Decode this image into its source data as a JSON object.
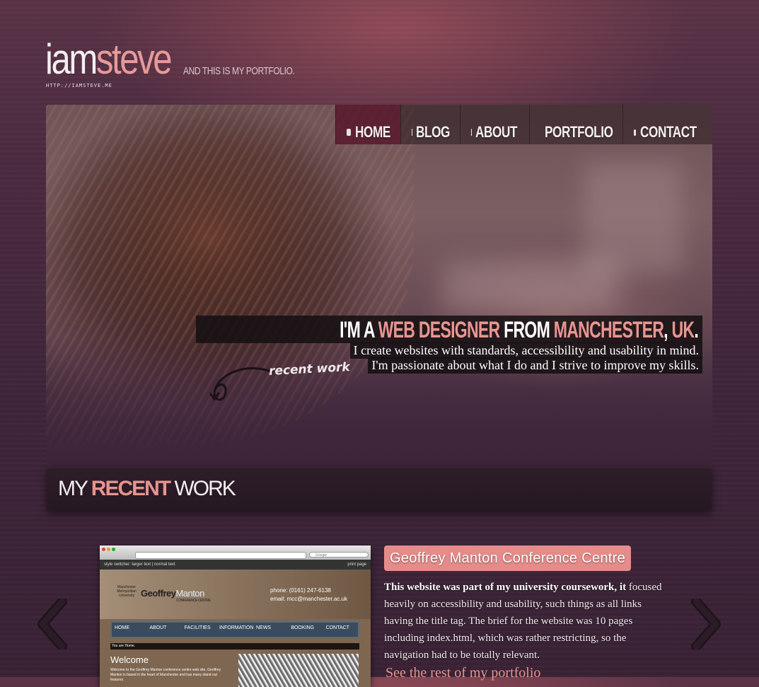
{
  "logo": {
    "iam": "iam",
    "steve": "steve",
    "tagline": "AND THIS IS MY PORTFOLIO.",
    "url": "HTTP://IAMSTEVE.ME"
  },
  "nav": {
    "items": [
      {
        "label": "HOME",
        "icon": "home-icon",
        "active": true
      },
      {
        "label": "BLOG",
        "icon": "speech-bubble-icon",
        "active": false
      },
      {
        "label": "ABOUT",
        "icon": "person-icon",
        "active": false
      },
      {
        "label": "PORTFOLIO",
        "icon": "document-icon",
        "active": false
      },
      {
        "label": "CONTACT",
        "icon": "mail-icon",
        "active": false
      }
    ]
  },
  "hero": {
    "headline_1": "I'M A ",
    "headline_2": "WEB DESIGNER",
    "headline_3": " FROM ",
    "headline_4": "MANCHESTER",
    "headline_5": ", ",
    "headline_6": "UK",
    "headline_7": ".",
    "line1": "I create websites with standards, accessibility and usability in mind.",
    "line2": "I'm passionate about what I do and I strive to improve my skills.",
    "recent_work_hand": "recent work"
  },
  "section": {
    "title_1": "MY ",
    "title_2": "RECENT",
    "title_3": " WORK"
  },
  "project": {
    "title": "Geoffrey Manton Conference Centre",
    "description_bold": "This website was part of my university coursework, it",
    "description_rest": " focused heavily on accessibility and usability, such things as all links having the title tag. The brief for the website was 10 pages including index.html, which was rather restricting, so the navigation had to be totally relevant.",
    "link": "See the rest of my portfolio",
    "screenshot": {
      "search": "Google",
      "style_switcher": "style switcher: larger text | normal text",
      "print": "print page",
      "logo_a": "Geoffrey",
      "logo_b": "Manton",
      "logo_sub": "CONFERENCE CENTRE",
      "uni": "Manchester Metropolitan University",
      "phone": "phone: (0161) 247-6138",
      "email": "email: mcc@manchester.ac.uk",
      "nav": [
        "HOME",
        "ABOUT",
        "FACILITIES",
        "INFORMATION",
        "NEWS",
        "BOOKING",
        "CONTACT"
      ],
      "home_bar": "You are Home.",
      "welcome": "Welcome",
      "body": "Welcome to the Geoffrey Manton conference centre web site, Geoffrey Manton is based in the heart of Manchester and has many stand out features"
    }
  },
  "colors": {
    "accent_pink": "#e8938f",
    "background": "#3e2539",
    "nav_active": "#5f1e32"
  }
}
